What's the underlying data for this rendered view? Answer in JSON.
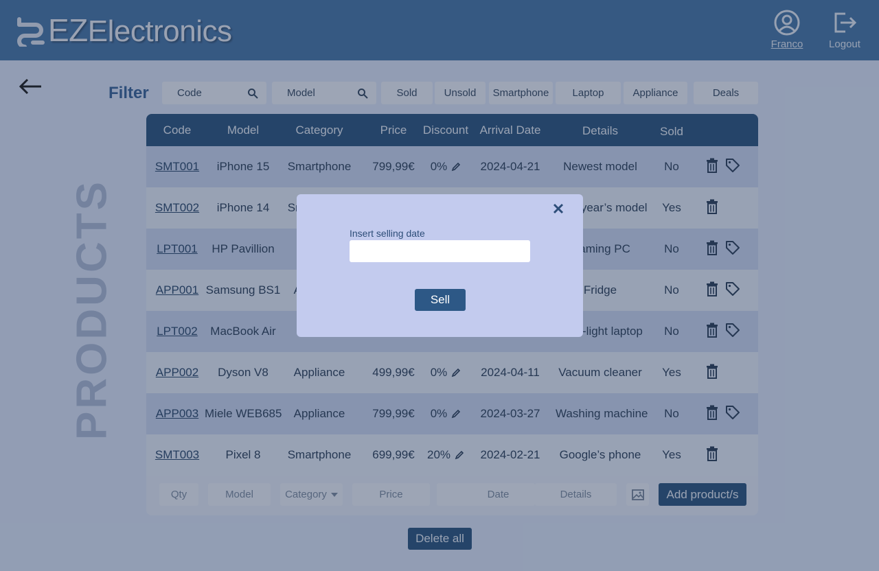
{
  "header": {
    "logo_ez": "EZ",
    "logo_rest": "Electronics",
    "user_label": "Franco",
    "logout_label": "Logout"
  },
  "page_title": "PRODUCTS",
  "filter": {
    "label": "Filter",
    "code_placeholder": "Code",
    "model_placeholder": "Model",
    "buttons": [
      "Sold",
      "Unsold",
      "Smartphone",
      "Laptop",
      "Appliance",
      "Deals"
    ]
  },
  "table": {
    "headers": [
      "Code",
      "Model",
      "Category",
      "Price",
      "Discount",
      "Arrival Date",
      "Details",
      "Sold"
    ],
    "rows": [
      {
        "code": "SMT001",
        "model": "iPhone 15",
        "category": "Smartphone",
        "price": "799,99€",
        "discount": "0%",
        "arrival": "2024-04-21",
        "details": "Newest model",
        "sold": "No"
      },
      {
        "code": "SMT002",
        "model": "iPhone 14",
        "category": "Smartphone",
        "price": "",
        "discount": "",
        "arrival": "",
        "details": "Last year’s model",
        "sold": "Yes"
      },
      {
        "code": "LPT001",
        "model": "HP Pavillion",
        "category": "",
        "price": "",
        "discount": "",
        "arrival": "",
        "details": "Gaming PC",
        "sold": "No"
      },
      {
        "code": "APP001",
        "model": "Samsung BS1",
        "category": "Appliance",
        "price": "",
        "discount": "",
        "arrival": "",
        "details": "Fridge",
        "sold": "No"
      },
      {
        "code": "LPT002",
        "model": "MacBook Air",
        "category": "",
        "price": "",
        "discount": "",
        "arrival": "",
        "details": "Ultra-light laptop",
        "sold": "No"
      },
      {
        "code": "APP002",
        "model": "Dyson V8",
        "category": "Appliance",
        "price": "499,99€",
        "discount": "0%",
        "arrival": "2024-04-11",
        "details": "Vacuum cleaner",
        "sold": "Yes"
      },
      {
        "code": "APP003",
        "model": "Miele WEB685",
        "category": "Appliance",
        "price": "799,99€",
        "discount": "0%",
        "arrival": "2024-03-27",
        "details": "Washing machine",
        "sold": "No"
      },
      {
        "code": "SMT003",
        "model": "Pixel 8",
        "category": "Smartphone",
        "price": "699,99€",
        "discount": "20%",
        "arrival": "2024-02-21",
        "details": "Google’s phone",
        "sold": "Yes"
      }
    ]
  },
  "add_row": {
    "qty": "Qty",
    "model": "Model",
    "category": "Category",
    "price": "Price",
    "date": "Date",
    "details": "Details",
    "add_label": "Add product/s"
  },
  "delete_all_label": "Delete all",
  "modal": {
    "label": "Insert selling date",
    "input_value": "",
    "sell_label": "Sell"
  },
  "colors": {
    "header": "#3d6ea3",
    "table_header": "#1f4a77",
    "modal_bg": "#c3cbee",
    "sell_button": "#2d5886"
  }
}
